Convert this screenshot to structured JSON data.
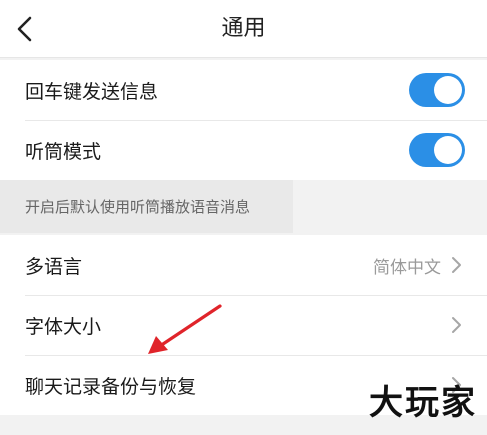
{
  "header": {
    "title": "通用"
  },
  "group1": [
    {
      "label": "回车键发送信息",
      "toggle_on": true
    },
    {
      "label": "听筒模式",
      "toggle_on": true
    }
  ],
  "hint": "开启后默认使用听筒播放语音消息",
  "group2": [
    {
      "label": "多语言",
      "value": "简体中文"
    },
    {
      "label": "字体大小",
      "value": ""
    },
    {
      "label": "聊天记录备份与恢复",
      "value": ""
    }
  ],
  "colors": {
    "accent": "#2b8fe6",
    "annotation_arrow": "#e0242a"
  },
  "icons": {
    "back": "chevron-left-icon",
    "row_arrow": "chevron-right-icon"
  },
  "watermark": "大玩家"
}
